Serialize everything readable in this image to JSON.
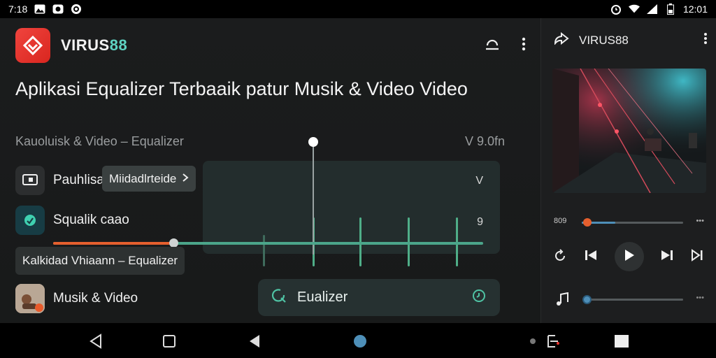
{
  "status_bar": {
    "time": "7:18",
    "clock_right": "12:01",
    "icons_left": [
      "gallery-icon",
      "messenger-icon",
      "at-icon"
    ],
    "icons_right": [
      "alarm-icon",
      "wifi-icon",
      "signal-icon",
      "battery-icon"
    ]
  },
  "app": {
    "name_main": "VIRUS",
    "name_accent": "88",
    "logo_icon": "diamond-logo-icon",
    "header_actions": [
      "cast-icon",
      "more-vert-icon"
    ]
  },
  "headline": "Aplikasi Equalizer Terbaaik patur Musik & Video Video",
  "subline": {
    "left": "Kauoluisk & Video – Equalizer",
    "right": "V 9.0fn"
  },
  "rows": [
    {
      "label": "Pauhlisa",
      "icon": "screen-icon",
      "chip": "Miidadlrteide",
      "value": "V"
    },
    {
      "label": "Squalik caao",
      "icon": "leaf-icon",
      "value": "9"
    },
    {
      "label": "Musik & Video",
      "icon": "album-icon"
    }
  ],
  "equalizer_chip": "Kalkidad Vhiaann – Equalizer",
  "equalizer_button": {
    "label": "Eualizer",
    "left_icon": "refresh-search-icon",
    "right_icon": "timer-icon"
  },
  "balance_slider": {
    "value": 0.28
  },
  "eq_bars": [
    0.5,
    0.78,
    0.78,
    0.78,
    0.78
  ],
  "player": {
    "title": "VIRUS88",
    "time_current": "809",
    "progress": 0.33,
    "volume": 0.04,
    "controls": [
      "replay-icon",
      "prev-icon",
      "play-icon",
      "next-icon",
      "skip-icon"
    ],
    "volume_icon": "music-note-icon"
  },
  "nav": [
    "back-triangle-icon",
    "home-square-icon",
    "back-filled-icon",
    "home-circle-icon",
    "screenshot-icon",
    "recent-square-icon"
  ],
  "colors": {
    "accent_teal": "#5fd3c2",
    "logo_red": "#e8332d",
    "slider_orange": "#e45f2e",
    "slider_teal": "#4ba58a",
    "progress_blue": "#4e8fb8"
  }
}
